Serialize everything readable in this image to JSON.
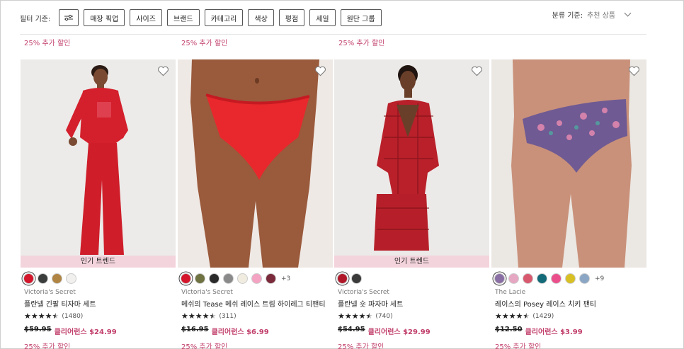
{
  "filters": {
    "label": "필터 기준:",
    "chips": [
      "매장 픽업",
      "사이즈",
      "브랜드",
      "카테고리",
      "색상",
      "평점",
      "세일",
      "원단 그룹"
    ]
  },
  "sort": {
    "label": "분류 기준:",
    "value": "추천 상품"
  },
  "top_promos": [
    "25% 추가 할인",
    "25% 추가 할인",
    "25% 추가 할인"
  ],
  "products": [
    {
      "badge": "인기 트렌드",
      "brand": "Victoria's Secret",
      "name": "플란넬 긴팔 티자마 세트",
      "rating_count": "(1480)",
      "old_price": "$59.95",
      "sale_price": "클리어런스 $24.99",
      "promo": "25% 추가 할인",
      "swatches": [
        "#d3162b",
        "#3b3d3c",
        "#b08443",
        "#f1f0ee"
      ],
      "more": ""
    },
    {
      "badge": "",
      "brand": "Victoria's Secret",
      "name": "메쉬의 Tease 메쉬 레이스 트림 하이레그 티팬티",
      "rating_count": "(311)",
      "old_price": "$16.95",
      "sale_price": "클리어런스 $6.99",
      "promo": "25% 추가 할인",
      "swatches": [
        "#d3162b",
        "#6f7241",
        "#2a2a2a",
        "#8a8a8a",
        "#f1ece0",
        "#f4a3c3",
        "#7a2a3a"
      ],
      "more": "+3"
    },
    {
      "badge": "인기 트렌드",
      "brand": "Victoria's Secret",
      "name": "플란넬 숏 파자마 세트",
      "rating_count": "(740)",
      "old_price": "$54.95",
      "sale_price": "클리어런스 $29.99",
      "promo": "25% 추가 할인",
      "swatches": [
        "#b0182a",
        "#3a3a3a"
      ],
      "more": ""
    },
    {
      "badge": "",
      "brand": "The Lacie",
      "name": "레이스의 Posey 레이스 치키 팬티",
      "rating_count": "(1429)",
      "old_price": "$12.50",
      "sale_price": "클리어런스 $3.99",
      "promo": "25% 추가 할인",
      "swatches": [
        "#8a6fa5",
        "#e6a7c2",
        "#d8596e",
        "#136a79",
        "#ea4f8c",
        "#d8c024",
        "#8aa6c4"
      ],
      "more": "+9"
    }
  ],
  "colors": {
    "accent": "#c2406b",
    "badge_bg": "#f4d4dc"
  }
}
